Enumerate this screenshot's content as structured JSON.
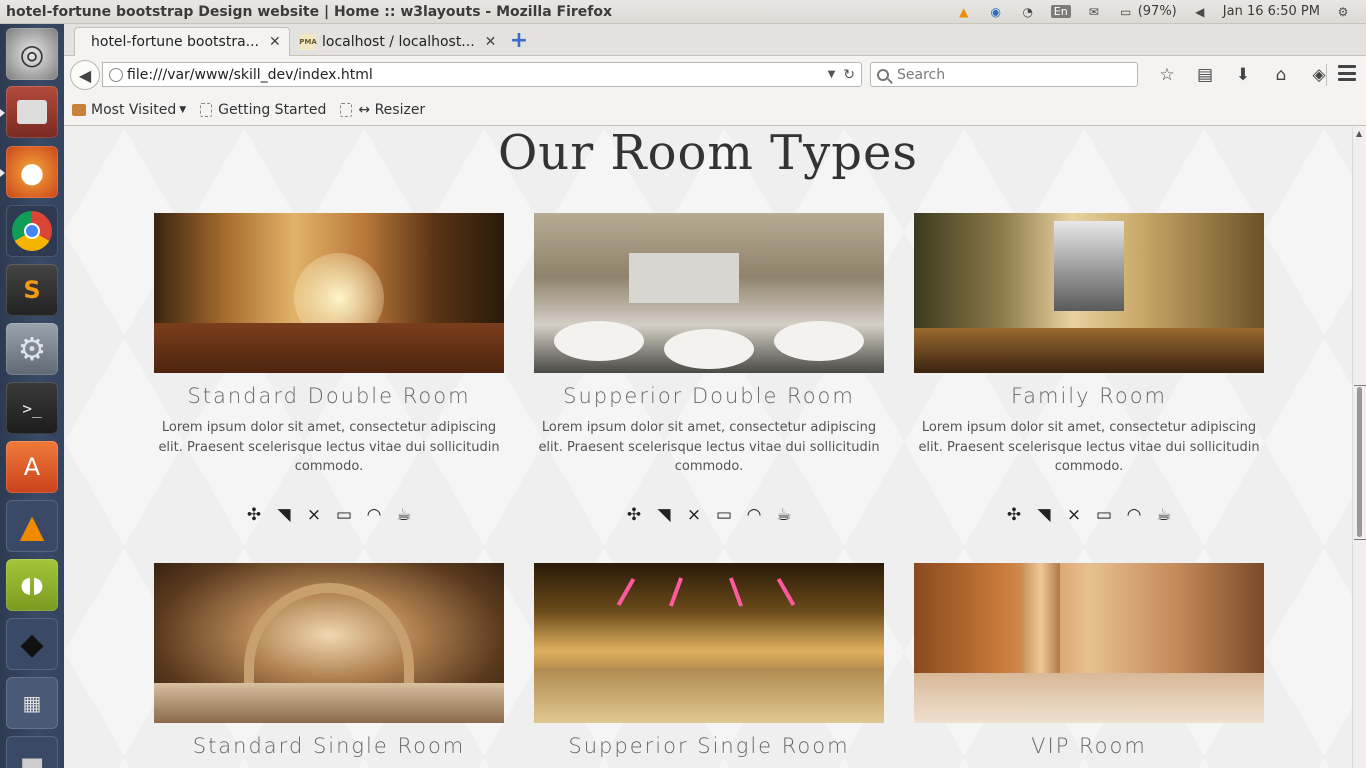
{
  "window": {
    "title": "hotel-fortune bootstrap Design website | Home :: w3layouts - Mozilla Firefox"
  },
  "indicators": {
    "lang": "En",
    "battery": "(97%)",
    "clock": "Jan 16  6:50 PM"
  },
  "tabs": [
    {
      "label": "hotel-fortune bootstra...",
      "close": "✕"
    },
    {
      "icon_text": "PMA",
      "label": "localhost / localhost...",
      "close": "✕"
    }
  ],
  "newtab": "+",
  "url": {
    "value": "file:///var/www/skill_dev/index.html"
  },
  "search": {
    "placeholder": "Search"
  },
  "bookmarks": [
    {
      "label": "Most Visited"
    },
    {
      "label": "Getting Started"
    },
    {
      "label": "↔ Resizer"
    }
  ],
  "page": {
    "heading": "Our Room Types",
    "rooms": [
      {
        "name": "Standard Double Room",
        "desc": "Lorem ipsum dolor sit amet, consectetur adipiscing elit. Praesent scelerisque lectus vitae dui sollicitudin commodo."
      },
      {
        "name": "Supperior Double Room",
        "desc": "Lorem ipsum dolor sit amet, consectetur adipiscing elit. Praesent scelerisque lectus vitae dui sollicitudin commodo."
      },
      {
        "name": "Family Room",
        "desc": "Lorem ipsum dolor sit amet, consectetur adipiscing elit. Praesent scelerisque lectus vitae dui sollicitudin commodo."
      },
      {
        "name": "Standard Single Room"
      },
      {
        "name": "Supperior Single Room"
      },
      {
        "name": "VIP Room"
      }
    ],
    "amenity_icons": [
      "fan-icon",
      "hairdryer-icon",
      "hanger-icon",
      "tv-icon",
      "wifi-icon",
      "coffee-icon"
    ]
  },
  "launcher": [
    "ubuntu-icon",
    "files-icon",
    "firefox-icon",
    "chrome-icon",
    "sublime-icon",
    "settings-icon",
    "terminal-icon",
    "software-center-icon",
    "vlc-icon",
    "android-icon",
    "inkscape-icon",
    "workspaces-icon",
    "trash-icon"
  ]
}
